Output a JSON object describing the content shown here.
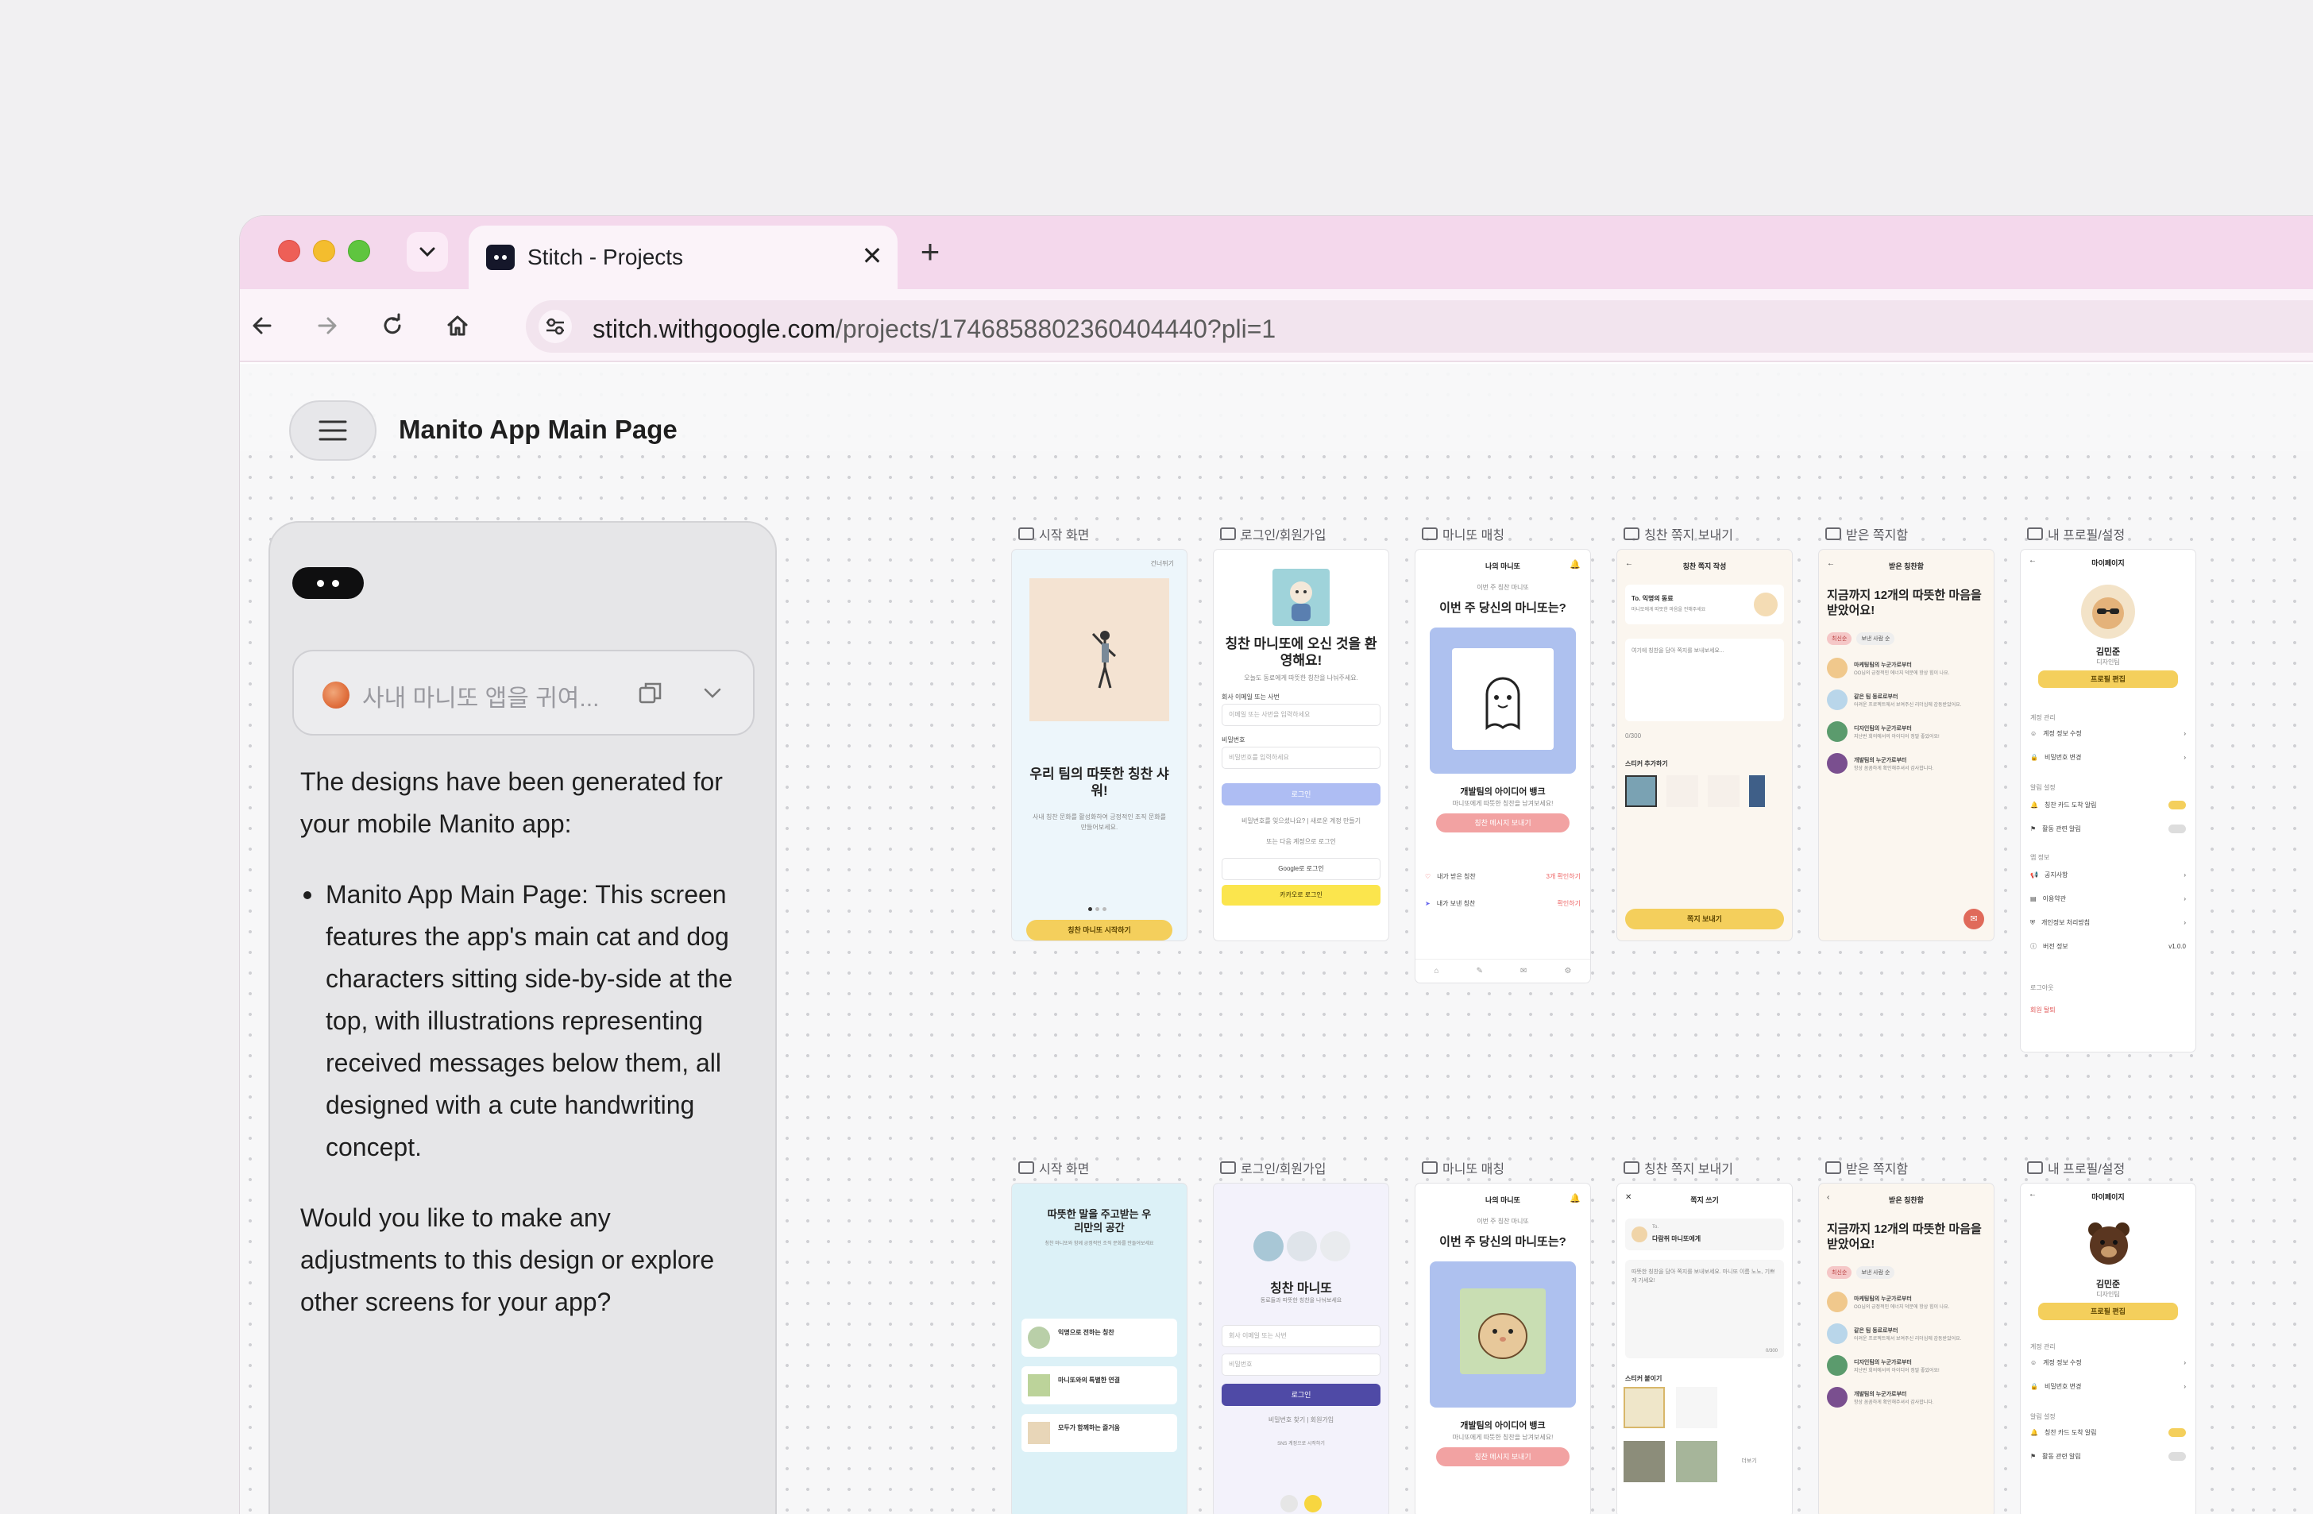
{
  "browser": {
    "tab_title": "Stitch - Projects",
    "tab_close": "✕",
    "new_tab": "+",
    "url_host": "stitch.withgoogle.com",
    "url_path": "/projects/17468588023604044​40?pli=1"
  },
  "app": {
    "project_title": "Manito App Main Page"
  },
  "chat": {
    "prompt_preview": "사내 마니또 앱을 귀여...",
    "intro": "The designs have been generated for your mobile Manito app:",
    "bullet": "Manito App Main Page: This screen features the app's main cat and dog characters sitting side-by-side at the top, with illustrations representing received messages below them, all designed with a cute handwriting concept.",
    "followup": "Would you like to make any adjustments to this design or explore other screens for your app?"
  },
  "screens": {
    "labels": [
      "시작 화면",
      "로그인/회원가입",
      "마니또 매칭",
      "칭찬 쪽지 보내기",
      "받은 쪽지함",
      "내 프로필/설정"
    ],
    "s1": {
      "skip": "건너뛰기",
      "title": "우리 팀의 따뜻한 칭찬 샤워!",
      "desc": "사내 칭찬 문화를 활성화하여 긍정적인 조직 문화를 만들어보세요.",
      "cta": "칭찬 마니또 시작하기"
    },
    "s2": {
      "title": "칭찬 마니또에 오신 것을 환영해요!",
      "sub": "오늘도 동료에게 따뜻한 칭찬을 나눠주세요.",
      "email_label": "회사 이메일 또는 사번",
      "email_ph": "이메일 또는 사번을 입력하세요",
      "pw_label": "비밀번호",
      "pw_ph": "비밀번호를 입력하세요",
      "login": "로그인",
      "links": "비밀번호를 잊으셨나요? | 새로운 계정 만들기",
      "or": "또는 다음 계정으로 로그인",
      "google": "Google로 로그인",
      "kakao": "카카오로 로그인"
    },
    "s3": {
      "top": "나의 마니또",
      "date": "이번 주 칭찬 마니또",
      "q": "이번 주 당신의 마니또는?",
      "name": "개발팀의 아이디어 뱅크",
      "desc": "마니또에게 따뜻한 칭찬을 남겨보세요!",
      "cta": "칭찬 메시지 보내기",
      "recv": "내가 받은 칭찬",
      "recv_link": "3개 확인하기",
      "sent": "내가 보낸 칭찬",
      "sent_link": "확인하기"
    },
    "s4": {
      "top": "칭찬 쪽지 작성",
      "to": "To. 익명의 동료",
      "to_sub": "마니또에게 따뜻한 마음을 전해주세요",
      "ph": "여기에 칭찬을 담아 쪽지를 보내보세요...",
      "count": "0/300",
      "sticker": "스티커 추가하기",
      "cta": "쪽지 보내기"
    },
    "s5": {
      "top": "받은 칭찬함",
      "head": "지금까지 12개의 따뜻한 마음을 받았어요!",
      "chip1": "최신순",
      "chip2": "보낸 사람 순",
      "items": [
        {
          "t": "마케팅팀의 누군가로부터",
          "d": "OO님의 긍정적인 에너지 덕분에 항상 힘이 나요."
        },
        {
          "t": "같은 팀 동료로부터",
          "d": "어려운 프로젝트에서 보여주신 리더십에 감동받았어요."
        },
        {
          "t": "디자인팀의 누군가로부터",
          "d": "지난번 회의에서의 아이디어 정말 좋았어요!"
        },
        {
          "t": "개발팀의 누군가로부터",
          "d": "항상 꼼꼼하게 확인해주셔서 감사합니다."
        }
      ]
    },
    "s6": {
      "top": "마이페이지",
      "name": "김민준",
      "role": "디자인팀",
      "edit": "프로필 편집",
      "sec1": "계정 관리",
      "i1": "계정 정보 수정",
      "i2": "비밀번호 변경",
      "sec2": "알림 설정",
      "i3": "칭찬 카드 도착 알림",
      "i4": "활동 관련 알림",
      "sec3": "앱 정보",
      "i5": "공지사항",
      "i6": "이용약관",
      "i7": "개인정보 처리방침",
      "i8": "버전 정보",
      "ver": "v1.0.0",
      "logout": "로그아웃",
      "leave": "회원 탈퇴"
    },
    "b1": {
      "title": "따뜻한 말을 주고받는 우리만의 공간",
      "sub": "칭찬 마니또와 함께 긍정적인 조직 문화를 만들어보세요",
      "c1": "익명으로 전하는 칭찬",
      "c2": "마니또와의 특별한 연결",
      "c3": "모두가 함께하는 즐거움"
    },
    "b2": {
      "title": "칭찬 마니또",
      "sub": "동료들과 따뜻한 칭찬을 나눠보세요",
      "email_ph": "회사 이메일 또는 사번",
      "pw_ph": "비밀번호",
      "login": "로그인",
      "links": "비밀번호 찾기 | 회원가입",
      "sns": "SNS 계정으로 시작하기"
    },
    "b4": {
      "top": "쪽지 쓰기",
      "to": "To.",
      "to_name": "다람쥐 마니또에게",
      "ph": "따뜻한 칭찬을 담아 쪽지를 보내보세요. 마니또 이름 노노, 기쁘게 가세요!",
      "count": "0/300",
      "sticker": "스티커 붙이기",
      "more": "더보기"
    },
    "b6": {
      "name": "김민준",
      "role": "디자인팀"
    }
  }
}
